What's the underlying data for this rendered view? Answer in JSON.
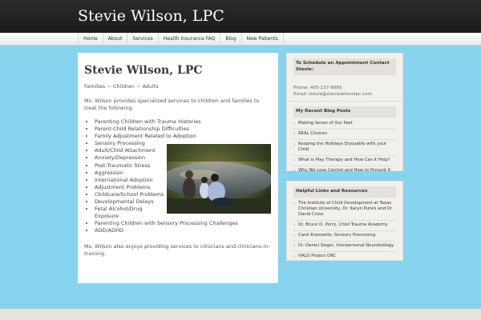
{
  "site": {
    "title": "Stevie Wilson, LPC"
  },
  "nav": [
    "Home",
    "About",
    "Services",
    "Health Insurance FAQ",
    "Blog",
    "New Patients"
  ],
  "page": {
    "title": "Stevie Wilson, LPC",
    "tagline": "Families  ~  Children  ~  Adults",
    "intro": "Ms. Wilson provides specialized services to children and families to treat the following:",
    "services": [
      "Parenting Children with Trauma Histories",
      "Parent-Child Relationship Difficulties",
      "Family Adjustment Related to Adoption",
      "Sensory Processing",
      "Adult/Child Attachment",
      "Anxiety/Depression",
      "Post-Traumatic Stress",
      "Aggression",
      "International Adoption",
      "Adjustment Problems",
      "Childcare/School Problems",
      "Developmental Delays",
      "Fetal Alcohol/Drug Exposure",
      "Parenting Children with Sensory Processing Challenges",
      "ADD/ADHD"
    ],
    "closing": "Ms. Wilson also enjoys providing services to clinicians and clinicians-in-training."
  },
  "sidebar": {
    "appointment": {
      "title": "To Schedule an Appointment Contact Stevie:",
      "phone": "Phone: 405-237-8665",
      "email": "Email: stevie@steviewilsonlpc.com"
    },
    "blog": {
      "title": "My Recent Blog Posts",
      "posts": [
        "Making Sense of Our Past",
        "REAL Choices",
        "Keeping the Holidays Enjoyable with your Child",
        "What is Play Therapy and How Can it Help?",
        "Why We Lose Control and How to Prevent It"
      ]
    },
    "links": {
      "title": "Helpful Links and Resources",
      "items": [
        "The Institute of Child Development at Texas Christian University, Dr. Karyn Purvis and Dr. David Cross",
        "Dr. Bruce D. Perry, Child Trauma Academy",
        "Carol Kranowitz, Sensory Processing",
        "Dr. Daniel Siegel, Interpersonal Neurobiology",
        "HALO Project OKC"
      ]
    }
  },
  "colors": {
    "background": "#86d3ee",
    "header": "#222222",
    "panel": "#ffffff",
    "widget": "#f1f0ed"
  },
  "photo": {
    "icon": "family-by-pond-photo"
  }
}
